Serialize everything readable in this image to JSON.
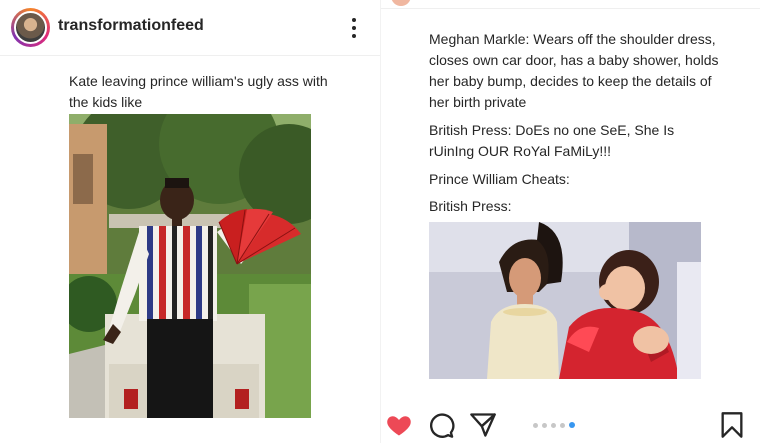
{
  "left_post": {
    "username": "transformationfeed",
    "caption": "Kate leaving prince william's ugly ass with the kids like"
  },
  "right_post": {
    "paragraphs": [
      "Meghan Markle: Wears off the shoulder dress, closes own car door, has a baby shower, holds her baby bump, decides to keep the details of her birth private",
      "British Press: DoEs no one SeE, She Is rUinIng OUR RoYal FaMiLy!!!",
      "Prince William Cheats:",
      "British Press:"
    ],
    "carousel": {
      "count": 5,
      "active_index": 4
    }
  },
  "icons": {
    "more": "more-options-icon",
    "like": "heart-icon",
    "comment": "comment-icon",
    "share": "paper-plane-icon",
    "save": "bookmark-icon"
  },
  "colors": {
    "like_red": "#ed4956",
    "carousel_active": "#3897f0",
    "text": "#262626"
  }
}
